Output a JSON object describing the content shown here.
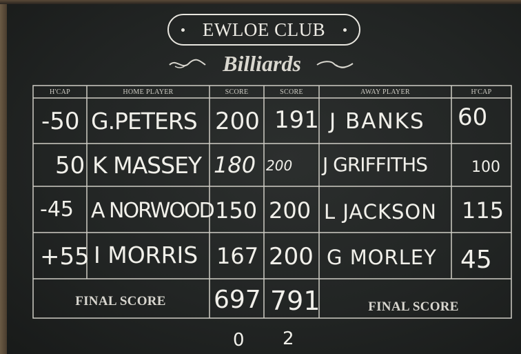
{
  "header": {
    "club": "EWLOE CLUB",
    "sport": "Billiards"
  },
  "columns": {
    "home_hcap": "H'CAP",
    "home_player": "HOME PLAYER",
    "home_score": "SCORE",
    "away_score": "SCORE",
    "away_player": "AWAY PLAYER",
    "away_hcap": "H'CAP"
  },
  "rows": [
    {
      "home_hcap": "-50",
      "home_player": "G.PETERS",
      "home_score": "200",
      "away_score": "191",
      "away_player": "J BANKS",
      "away_hcap": "60"
    },
    {
      "home_hcap": "50",
      "home_player": "K MASSEY",
      "home_score": "180",
      "away_score": "200",
      "away_player": "J GRIFFITHS",
      "away_hcap": "100"
    },
    {
      "home_hcap": "-45",
      "home_player": "A NORWOOD",
      "home_score": "150",
      "away_score": "200",
      "away_player": "L JACKSON",
      "away_hcap": "115"
    },
    {
      "home_hcap": "+55",
      "home_player": "I MORRIS",
      "home_score": "167",
      "away_score": "200",
      "away_player": "G MORLEY",
      "away_hcap": "45"
    }
  ],
  "final": {
    "home_label": "FINAL SCORE",
    "home_total": "697",
    "away_total": "791",
    "away_label": "FINAL SCORE"
  },
  "result": {
    "home": "0",
    "away": "2"
  }
}
